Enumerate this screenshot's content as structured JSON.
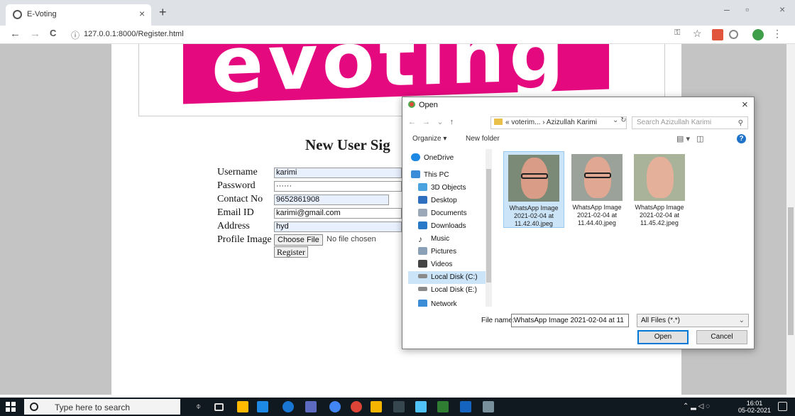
{
  "browser": {
    "tab_title": "E-Voting",
    "tab_close": "×",
    "new_tab": "+",
    "url": "127.0.0.1:8000/Register.html",
    "info_icon": "ⓘ",
    "back": "←",
    "forward": "→",
    "reload": "C",
    "minimize": "–",
    "restore": "▫",
    "close": "×"
  },
  "page": {
    "logo_text": "evoting",
    "heading": "New User Sig",
    "form": {
      "username_label": "Username",
      "username_value": "karimi",
      "password_label": "Password",
      "password_value": "······",
      "contact_label": "Contact No",
      "contact_value": "9652861908",
      "email_label": "Email ID",
      "email_value": "karimi@gmail.com",
      "address_label": "Address",
      "address_value": "hyd",
      "profile_label": "Profile Image",
      "choose_file_label": "Choose File",
      "no_file_text": "No file chosen",
      "register_label": "Register"
    }
  },
  "dialog": {
    "title": "Open",
    "close": "×",
    "path": "« voterim... › Azizullah Karimi",
    "search_placeholder": "Search Azizullah Karimi",
    "organize_label": "Organize ▾",
    "new_folder_label": "New folder",
    "help": "?",
    "nav_items": [
      {
        "label": "OneDrive",
        "color": "#1e88e5"
      },
      {
        "label": "This PC",
        "color": "#3c8dd8"
      },
      {
        "label": "3D Objects",
        "color": "#4aa3df"
      },
      {
        "label": "Desktop",
        "color": "#2f6fbf"
      },
      {
        "label": "Documents",
        "color": "#9aa8b8"
      },
      {
        "label": "Downloads",
        "color": "#2979c9"
      },
      {
        "label": "Music",
        "color": "#333333"
      },
      {
        "label": "Pictures",
        "color": "#8aa0b6"
      },
      {
        "label": "Videos",
        "color": "#444444"
      },
      {
        "label": "Local Disk (C:)",
        "color": "#8a8a8a"
      },
      {
        "label": "Local Disk (E:)",
        "color": "#8a8a8a"
      },
      {
        "label": "Network",
        "color": "#3c8dd8"
      }
    ],
    "files": [
      {
        "line1": "WhatsApp Image",
        "line2": "2021-02-04 at",
        "line3": "11.42.40.jpeg",
        "selected": true
      },
      {
        "line1": "WhatsApp Image",
        "line2": "2021-02-04 at",
        "line3": "11.44.40.jpeg",
        "selected": false
      },
      {
        "line1": "WhatsApp Image",
        "line2": "2021-02-04 at",
        "line3": "11.45.42.jpeg",
        "selected": false
      }
    ],
    "file_name_label": "File name:",
    "file_name_value": "WhatsApp Image 2021-02-04 at 11",
    "file_type_value": "All Files (*.*)",
    "open_label": "Open",
    "cancel_label": "Cancel"
  },
  "taskbar": {
    "search_placeholder": "Type here to search",
    "time": "16:01",
    "date": "05-02-2021"
  }
}
